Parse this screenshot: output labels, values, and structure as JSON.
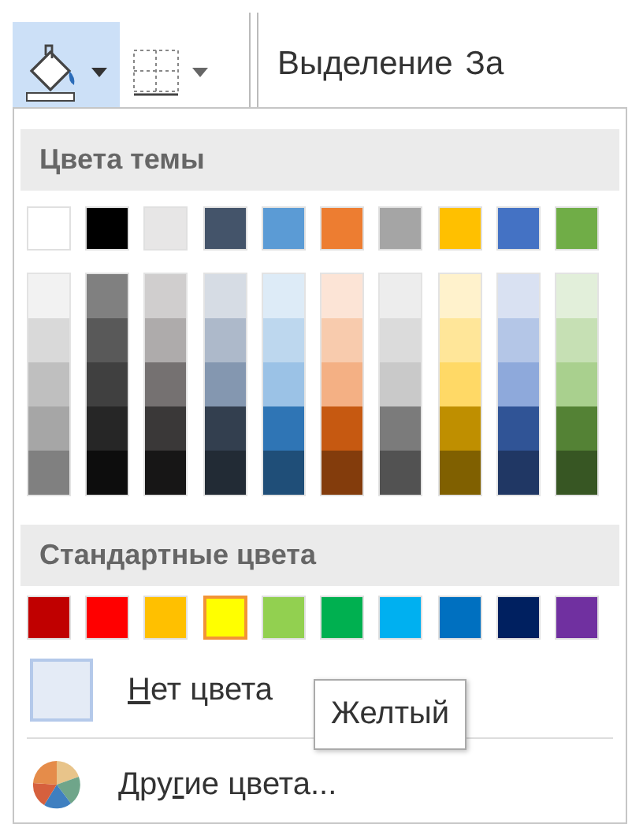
{
  "toolbar": {
    "fill_button": {
      "pressed": true
    },
    "border_button": {
      "pressed": false
    },
    "labels": [
      "Выделение",
      "За"
    ]
  },
  "menu": {
    "theme_title": "Цвета темы",
    "theme_colors": [
      {
        "color": "#ffffff",
        "shades": [
          {
            "color": "#f2f2f2"
          },
          {
            "color": "#d9d9d9"
          },
          {
            "color": "#bfbfbf"
          },
          {
            "color": "#a6a6a6"
          },
          {
            "color": "#808080"
          }
        ]
      },
      {
        "color": "#000000",
        "shades": [
          {
            "color": "#808080"
          },
          {
            "color": "#595959"
          },
          {
            "color": "#404040"
          },
          {
            "color": "#262626"
          },
          {
            "color": "#0d0d0d"
          }
        ]
      },
      {
        "color": "#e7e6e6",
        "shades": [
          {
            "color": "#d0cece"
          },
          {
            "color": "#aeabab"
          },
          {
            "color": "#757171"
          },
          {
            "color": "#3a3838"
          },
          {
            "color": "#171616"
          }
        ]
      },
      {
        "color": "#44546a",
        "shades": [
          {
            "color": "#d6dce4"
          },
          {
            "color": "#adb9ca"
          },
          {
            "color": "#8497b0"
          },
          {
            "color": "#333f4f"
          },
          {
            "color": "#222b35"
          }
        ]
      },
      {
        "color": "#5b9bd5",
        "shades": [
          {
            "color": "#ddebf7"
          },
          {
            "color": "#bdd7ee"
          },
          {
            "color": "#9bc2e6"
          },
          {
            "color": "#2f75b5"
          },
          {
            "color": "#1f4e78"
          }
        ]
      },
      {
        "color": "#ed7d31",
        "shades": [
          {
            "color": "#fce4d6"
          },
          {
            "color": "#f8cbad"
          },
          {
            "color": "#f4b084"
          },
          {
            "color": "#c65911"
          },
          {
            "color": "#833c0c"
          }
        ]
      },
      {
        "color": "#a5a5a5",
        "shades": [
          {
            "color": "#ededed"
          },
          {
            "color": "#dbdbdb"
          },
          {
            "color": "#c9c9c9"
          },
          {
            "color": "#7b7b7b"
          },
          {
            "color": "#525252"
          }
        ]
      },
      {
        "color": "#ffc000",
        "shades": [
          {
            "color": "#fff2cc"
          },
          {
            "color": "#ffe699"
          },
          {
            "color": "#ffd966"
          },
          {
            "color": "#bf8f00"
          },
          {
            "color": "#806000"
          }
        ]
      },
      {
        "color": "#4472c4",
        "shades": [
          {
            "color": "#d9e1f2"
          },
          {
            "color": "#b4c6e7"
          },
          {
            "color": "#8ea9db"
          },
          {
            "color": "#305496"
          },
          {
            "color": "#203764"
          }
        ]
      },
      {
        "color": "#70ad47",
        "shades": [
          {
            "color": "#e2efda"
          },
          {
            "color": "#c6e0b4"
          },
          {
            "color": "#a9d08e"
          },
          {
            "color": "#548235"
          },
          {
            "color": "#375623"
          }
        ]
      }
    ],
    "standard_title": "Стандартные цвета",
    "standard_colors": [
      {
        "color": "#c00000",
        "selected": false
      },
      {
        "color": "#ff0000",
        "selected": false
      },
      {
        "color": "#ffc000",
        "selected": false
      },
      {
        "color": "#ffff00",
        "selected": true
      },
      {
        "color": "#92d050",
        "selected": false
      },
      {
        "color": "#00b050",
        "selected": false
      },
      {
        "color": "#00b0f0",
        "selected": false
      },
      {
        "color": "#0070c0",
        "selected": false
      },
      {
        "color": "#002060",
        "selected": false
      },
      {
        "color": "#7030a0",
        "selected": false
      }
    ],
    "no_color": {
      "key": "Н",
      "after": "ет цвета"
    },
    "more_colors": {
      "before": "Дру",
      "key": "г",
      "after": "ие цвета..."
    }
  },
  "tooltip": "Желтый"
}
